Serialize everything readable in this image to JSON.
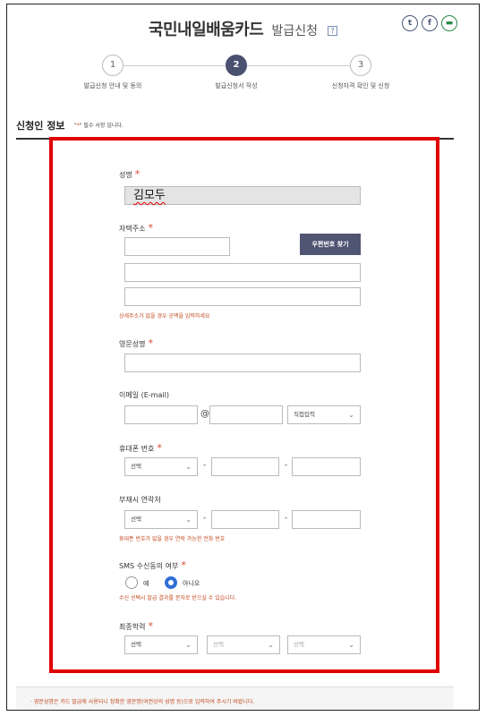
{
  "header": {
    "title": "국민내일배움카드",
    "subtitle": "발급신청",
    "help": "?",
    "share_twitter": "t",
    "share_facebook": "f",
    "share_other": "▬"
  },
  "steps": [
    {
      "num": "1",
      "label": "발급신청 안내 및 동의",
      "active": false
    },
    {
      "num": "2",
      "label": "발급신청서 작성",
      "active": true
    },
    {
      "num": "3",
      "label": "신청자격 확인 및 신청",
      "active": false
    }
  ],
  "section": {
    "title": "신청인 정보",
    "note_prefix": "\"",
    "note_star": "*",
    "note_suffix": "\" 필수 사항 입니다."
  },
  "form": {
    "name_label": "성명",
    "name_value": "김모두",
    "address_label": "자택주소",
    "postcode_button": "우편번호 찾기",
    "address_hint": "상세주소가 없을 경우 공백을 입력하세요",
    "eng_name_label": "영문성명",
    "email_label": "이메일 (E-mail)",
    "email_at": "@",
    "email_domain_select": "직접입력",
    "mobile_label": "휴대폰 번호",
    "mobile_select": "선택",
    "alt_label": "부재시 연락처",
    "alt_select": "선택",
    "alt_hint": "휴대폰 번호가 없을 경우 연락 가능한 전화 번호",
    "dash": "-",
    "sms_label": "SMS 수신동의 여부",
    "sms_yes": "예",
    "sms_no": "아니오",
    "sms_selected": "no",
    "sms_hint": "수신 선택시 발급 결과를 문자로 받으실 수 있습니다.",
    "edu_label": "최종학력",
    "edu_select1": "선택",
    "edu_select2": "선택",
    "edu_select3": "선택",
    "required_star": "*",
    "chevron": "⌄"
  },
  "footnote": {
    "line1": "· 영문성명은 카드 발급에 사용되니 정확한 영문명(여권상의 성명 등)으로 입력하여 주시기 바랍니다."
  },
  "colors": {
    "accent_dark": "#4f5573",
    "required": "#d9472b",
    "highlight": "#e00000",
    "radio_on": "#2f6fd6"
  }
}
